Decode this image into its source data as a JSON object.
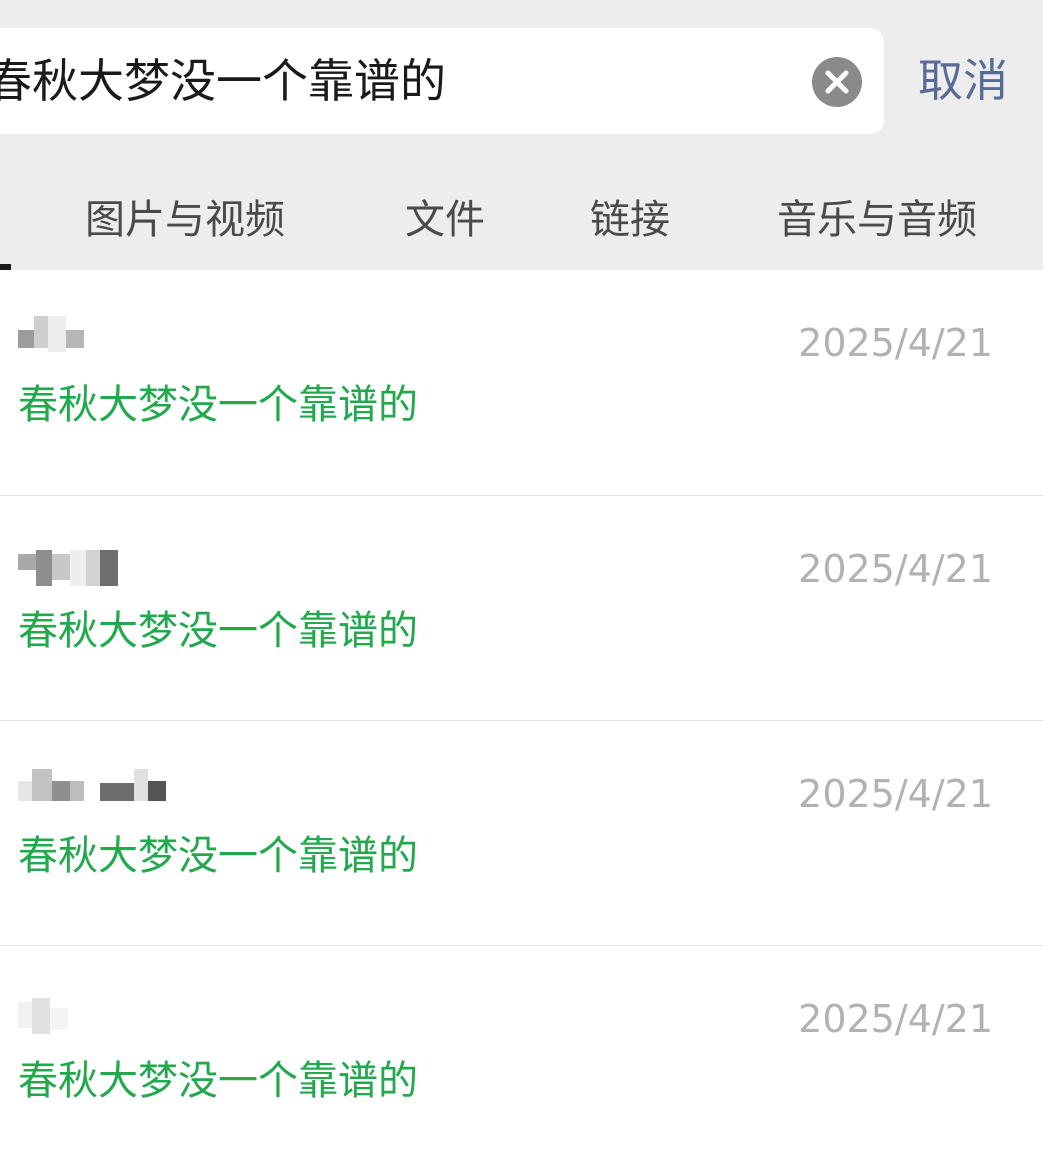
{
  "search": {
    "query": "春秋大梦没一个靠谱的",
    "cancel_label": "取消",
    "clear_icon": "close-circle-icon"
  },
  "tabs": [
    {
      "label": "图片与视频"
    },
    {
      "label": "文件"
    },
    {
      "label": "链接"
    },
    {
      "label": "音乐与音频"
    }
  ],
  "results": [
    {
      "date": "2025/4/21",
      "text": "春秋大梦没一个靠谱的"
    },
    {
      "date": "2025/4/21",
      "text": "春秋大梦没一个靠谱的"
    },
    {
      "date": "2025/4/21",
      "text": "春秋大梦没一个靠谱的"
    },
    {
      "date": "2025/4/21",
      "text": "春秋大梦没一个靠谱的"
    }
  ],
  "colors": {
    "header_bg": "#ededed",
    "accent_link": "#576b95",
    "match_green": "#22a94d",
    "date_gray": "#b2b2b2"
  }
}
